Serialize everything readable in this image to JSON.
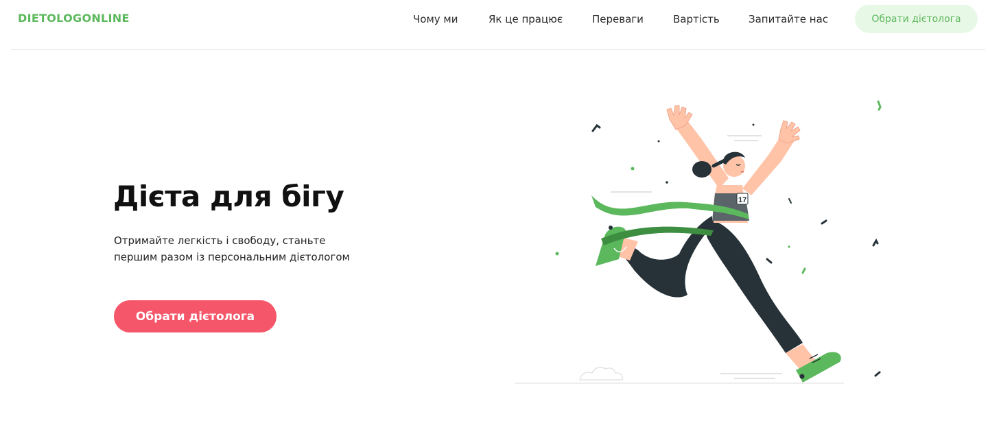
{
  "header": {
    "logo": "DIETOLOGONLINE",
    "nav": [
      {
        "label": "Чому ми"
      },
      {
        "label": "Як це працює"
      },
      {
        "label": "Переваги"
      },
      {
        "label": "Вартість"
      },
      {
        "label": "Запитайте нас"
      }
    ],
    "cta_label": "Обрати дієтолога"
  },
  "hero": {
    "title": "Дієта для бігу",
    "subtitle_line1": "Отримайте легкість і свободу, станьте",
    "subtitle_line2": "першим разом із персональним дієтологом",
    "cta_label": "Обрати дієтолога",
    "illustration_bib": "17"
  },
  "colors": {
    "brand_green": "#5cb85c",
    "header_cta_bg": "#e8f8e6",
    "hero_cta_bg": "#f5566a",
    "ribbon_green": "#5cb85c",
    "pants_dark": "#263238",
    "skin": "#ffc3a8"
  }
}
